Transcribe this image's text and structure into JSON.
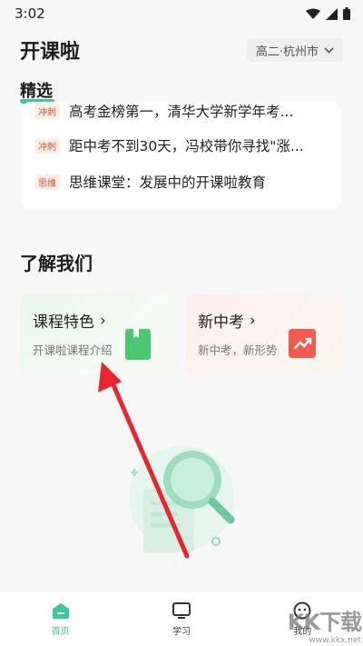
{
  "status_bar": {
    "time": "3:02"
  },
  "header": {
    "title": "开课啦",
    "location": "高二·杭州市"
  },
  "section": {
    "label": "精选"
  },
  "news": [
    {
      "tag": "",
      "text": "距中考不到30天，冯校带你寻找\"涨...",
      "visible_top": ""
    },
    {
      "tag": "冲刺",
      "text": "距中考不到30天，冯校带你寻找\"涨..."
    },
    {
      "tag": "思维",
      "text": "思维课堂：发展中的开课啦教育"
    }
  ],
  "partial_row": {
    "tag": "冲刺",
    "text": "高考金榜第一，清华大学新学年考..."
  },
  "about": {
    "title": "了解我们"
  },
  "features": [
    {
      "title": "课程特色",
      "chevron": "›",
      "subtitle": "开课啦课程介绍",
      "icon": "book-icon",
      "color": "#4cc872"
    },
    {
      "title": "新中考",
      "chevron": "›",
      "subtitle": "新中考，新形势",
      "icon": "trend-chart-icon",
      "color": "#f45a4c"
    }
  ],
  "bottom_nav": [
    {
      "label": "首页",
      "icon": "home-icon",
      "active": true
    },
    {
      "label": "学习",
      "icon": "monitor-icon",
      "active": false
    },
    {
      "label": "我的",
      "icon": "profile-icon",
      "active": false
    }
  ],
  "watermark": {
    "main": "KK下载",
    "url": "www.kkx.net"
  },
  "colors": {
    "accent": "#3ec79b",
    "arrow": "#e8262d"
  }
}
